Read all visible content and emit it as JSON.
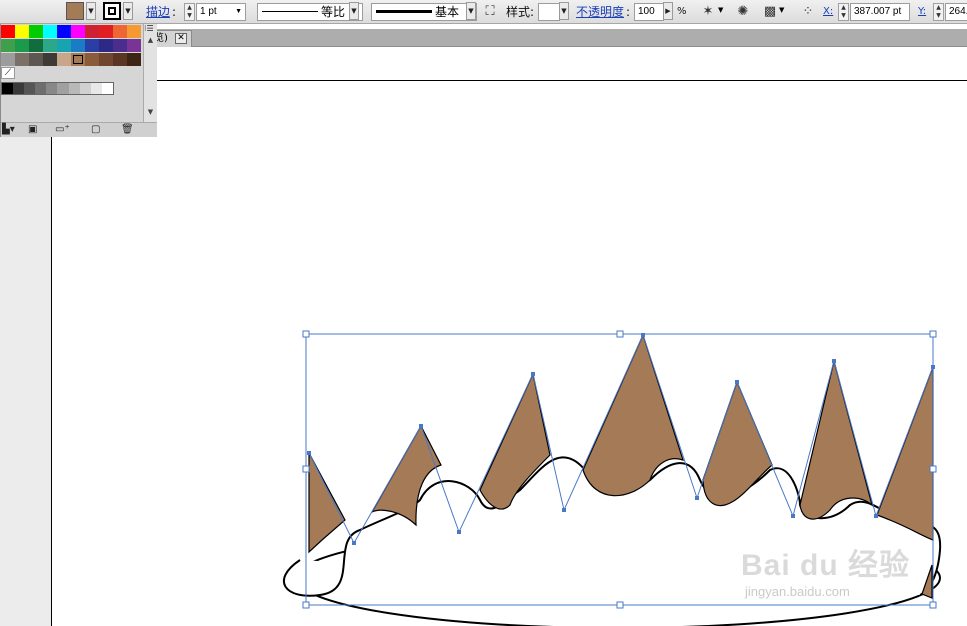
{
  "control_bar": {
    "fill_color": "#a57a57",
    "stroke_color": "#000000",
    "stroke_label": "描边",
    "stroke_colon": ":",
    "stroke_weight": "1 pt",
    "profile_label": "等比",
    "brush_label": "基本",
    "style_label": "样式:",
    "opacity_label": "不透明度",
    "opacity_colon": ":",
    "opacity_value": "100",
    "opacity_unit": "%",
    "x_label": "X:",
    "x_value": "387.007 pt",
    "y_label": "Y:",
    "y_value": "264."
  },
  "document_tab": {
    "label": "览)",
    "close_glyph": "✕"
  },
  "swatches_panel": {
    "menu_glyph": "⁝☰",
    "no_color_glyph": "⟋",
    "rows": [
      [
        "#ff0000",
        "#ffff00",
        "#00cc00",
        "#00ffff",
        "#0000ff",
        "#ff00ff",
        "#cc2233",
        "#e02020",
        "#ee6633",
        "#f59a30"
      ],
      [
        "#3ea04a",
        "#1c9a4c",
        "#126d3c",
        "#2aa888",
        "#17a3b0",
        "#1b7cc6",
        "#2a3fa6",
        "#2c2a86",
        "#4b2d8e",
        "#7a3496"
      ],
      [
        "#9c9c9c",
        "#7a7068",
        "#5e5650",
        "#3e3a36",
        "#c8a68a",
        "#a57a57",
        "#8a5c3c",
        "#704630",
        "#5a3622",
        "#3e2414"
      ]
    ],
    "selected_swatch": "#a57a57",
    "grays": [
      "#000000",
      "#3a3a3a",
      "#555555",
      "#6e6e6e",
      "#888888",
      "#a0a0a0",
      "#b8b8b8",
      "#d0d0d0",
      "#e8e8e8",
      "#ffffff"
    ],
    "footer_icons": [
      "library-menu-icon",
      "show-kinds-icon",
      "swatch-options-icon",
      "new-group-icon",
      "new-swatch-icon",
      "delete-icon"
    ]
  },
  "artwork": {
    "fill": "#a57a57",
    "stroke": "#000000",
    "selection_color": "#4a78c8"
  },
  "watermark": {
    "main": "Bai du 经验",
    "sub": "jingyan.baidu.com"
  }
}
